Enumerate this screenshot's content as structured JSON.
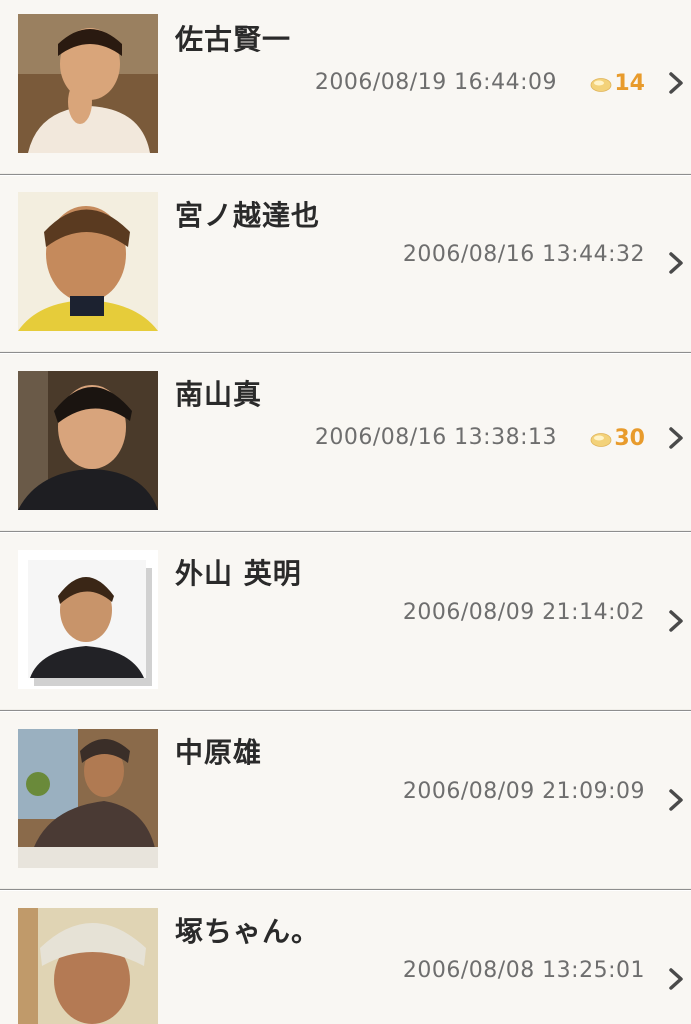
{
  "entries": [
    {
      "name": "佐古賢一",
      "date": "2006/08/19 16:44:09",
      "comment_count": "14",
      "avatar": "portrait-avatar"
    },
    {
      "name": "宮ノ越達也",
      "date": "2006/08/16 13:44:32",
      "comment_count": "",
      "avatar": "portrait-avatar"
    },
    {
      "name": "南山真",
      "date": "2006/08/16 13:38:13",
      "comment_count": "30",
      "avatar": "portrait-avatar"
    },
    {
      "name": "外山 英明",
      "date": "2006/08/09 21:14:02",
      "comment_count": "",
      "avatar": "portrait-avatar"
    },
    {
      "name": "中原雄",
      "date": "2006/08/09 21:09:09",
      "comment_count": "",
      "avatar": "portrait-avatar"
    },
    {
      "name": "塚ちゃん。",
      "date": "2006/08/08 13:25:01",
      "comment_count": "",
      "avatar": "portrait-avatar"
    }
  ],
  "colors": {
    "count_accent": "#e89b2c",
    "bubble_fill": "#f3d27a",
    "name_text": "#2a2a2a",
    "date_text": "#6e6e6e",
    "chevron": "#4a4a4a"
  },
  "icons": {
    "bubble": "comment-bubble-icon",
    "chevron": "chevron-right-icon"
  }
}
